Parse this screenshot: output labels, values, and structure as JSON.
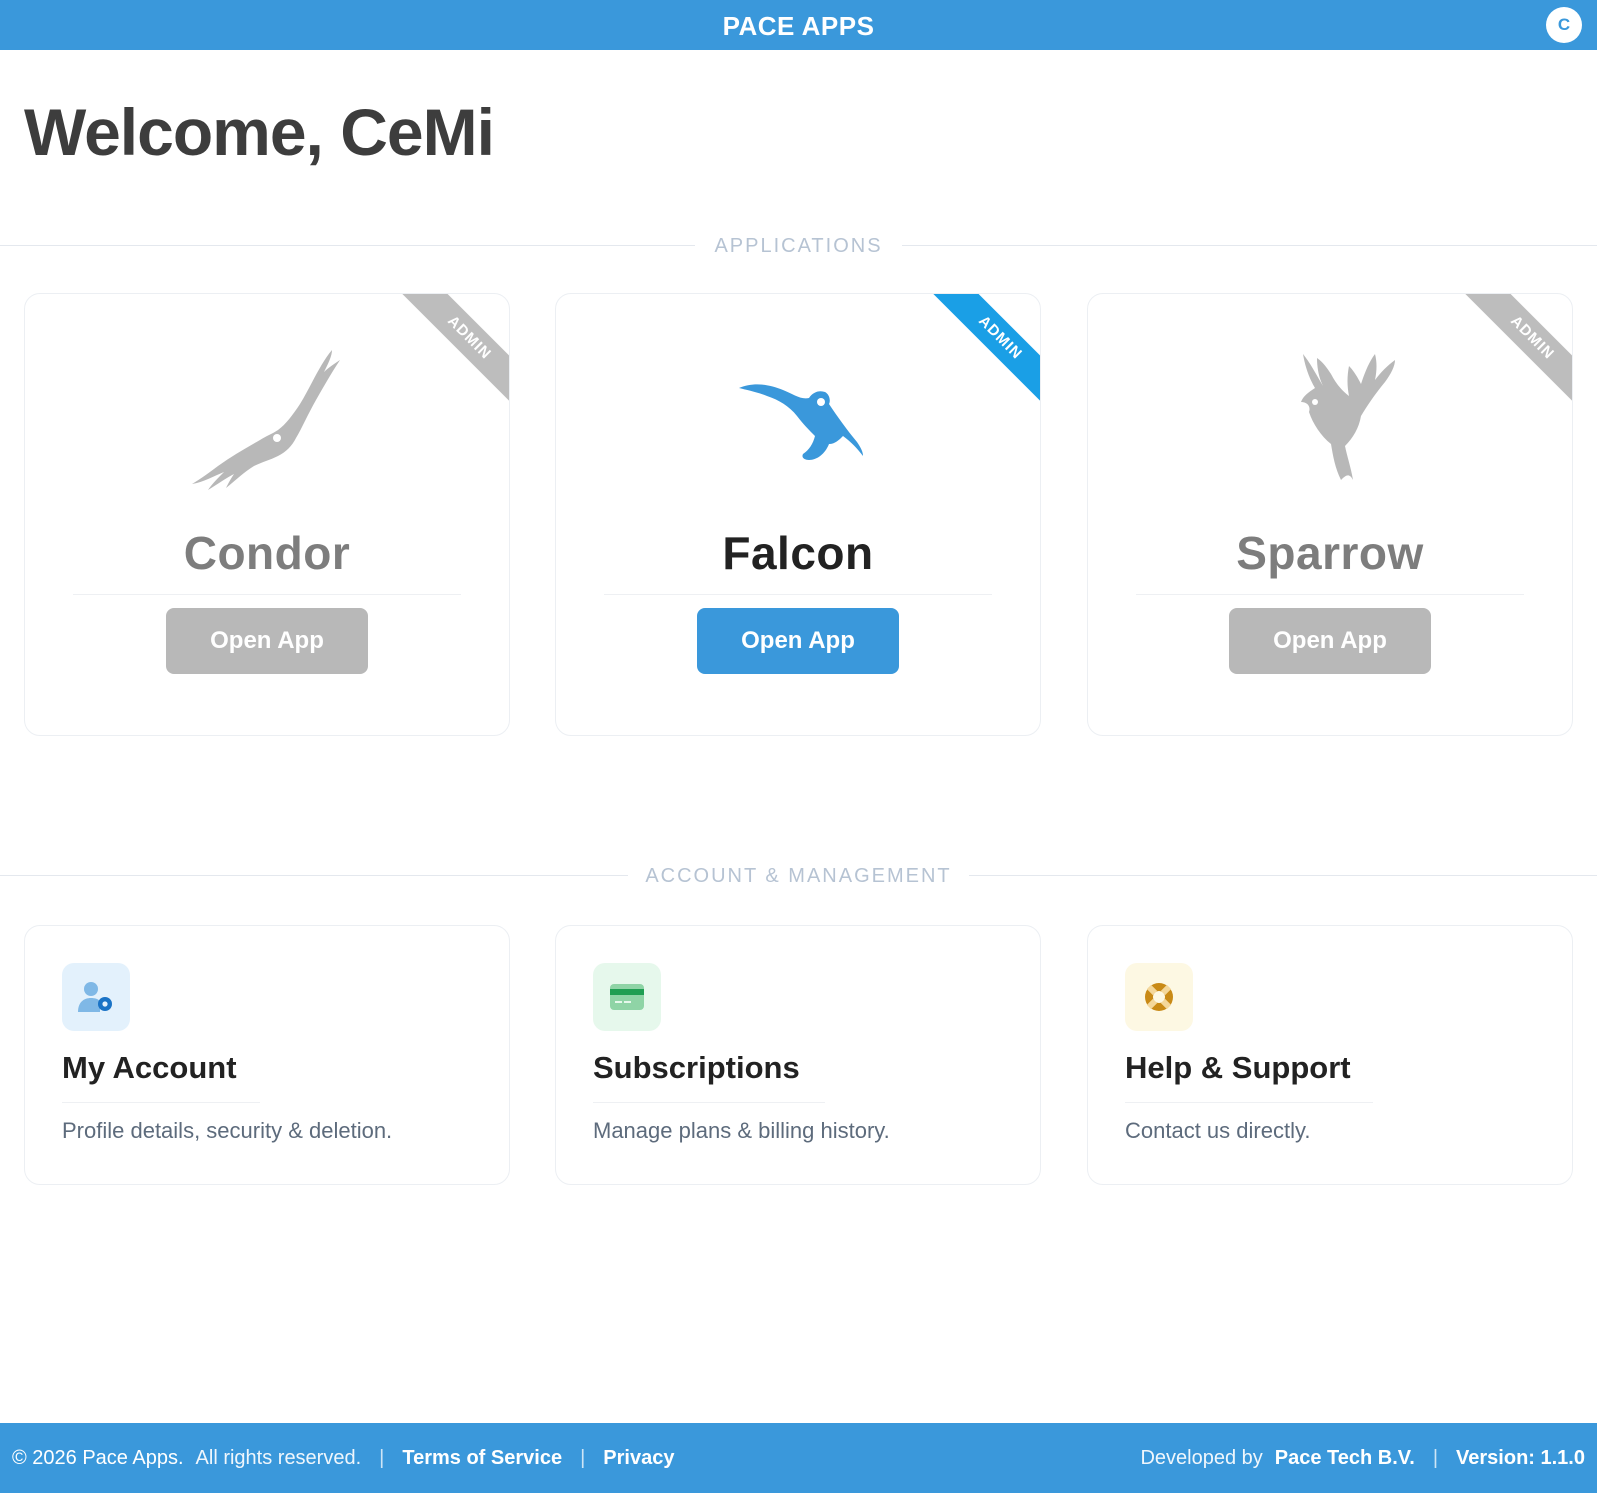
{
  "header": {
    "brand": "PACE APPS",
    "avatar_initial": "C"
  },
  "welcome": "Welcome, CeMi",
  "sections": {
    "applications": "APPLICATIONS",
    "account": "ACCOUNT & MANAGEMENT"
  },
  "apps": [
    {
      "name": "Condor",
      "badge": "ADMIN",
      "button": "Open App",
      "state": "inactive",
      "icon": "condor-icon"
    },
    {
      "name": "Falcon",
      "badge": "ADMIN",
      "button": "Open App",
      "state": "active",
      "icon": "falcon-icon"
    },
    {
      "name": "Sparrow",
      "badge": "ADMIN",
      "button": "Open App",
      "state": "inactive",
      "icon": "sparrow-icon"
    }
  ],
  "account_cards": [
    {
      "title": "My Account",
      "description": "Profile details, security & deletion.",
      "icon": "user-gear-icon"
    },
    {
      "title": "Subscriptions",
      "description": "Manage plans & billing history.",
      "icon": "credit-card-icon"
    },
    {
      "title": "Help & Support",
      "description": "Contact us directly.",
      "icon": "lifebuoy-icon"
    }
  ],
  "footer": {
    "copyright": "© 2026 Pace Apps.",
    "rights": "All rights reserved.",
    "terms": "Terms of Service",
    "privacy": "Privacy",
    "developed_by": "Developed by",
    "company": "Pace Tech B.V.",
    "version": "Version: 1.1.0"
  },
  "colors": {
    "primary": "#3a98db",
    "ribbon_active": "#1a9fe6",
    "inactive": "#b8b8b8"
  }
}
